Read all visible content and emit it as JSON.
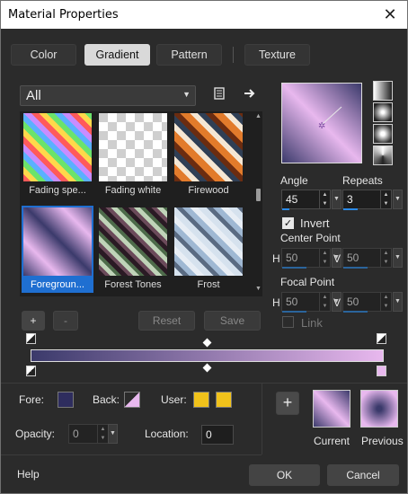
{
  "window": {
    "title": "Material Properties",
    "close_glyph": "✕"
  },
  "tabs": [
    {
      "label": "Color",
      "active": false
    },
    {
      "label": "Gradient",
      "active": true
    },
    {
      "label": "Pattern",
      "active": false
    },
    {
      "label": "Texture",
      "active": false
    }
  ],
  "filter": {
    "selected": "All"
  },
  "gallery": {
    "items": [
      {
        "label": "Fading spe...",
        "selected": false
      },
      {
        "label": "Fading white",
        "selected": false
      },
      {
        "label": "Firewood",
        "selected": false
      },
      {
        "label": "Foregroun...",
        "selected": true
      },
      {
        "label": "Forest Tones",
        "selected": false
      },
      {
        "label": "Frost",
        "selected": false
      }
    ]
  },
  "gallery_buttons": {
    "add": "+",
    "remove": "-",
    "reset": "Reset",
    "save": "Save"
  },
  "angle": {
    "label": "Angle",
    "value": "45"
  },
  "repeats": {
    "label": "Repeats",
    "value": "3"
  },
  "invert": {
    "label": "Invert",
    "checked": true
  },
  "center_point": {
    "label": "Center Point",
    "h_label": "H",
    "h_value": "50",
    "v_label": "V",
    "v_value": "50"
  },
  "focal_point": {
    "label": "Focal Point",
    "h_label": "H",
    "h_value": "50",
    "v_label": "V",
    "v_value": "50"
  },
  "link": {
    "label": "Link",
    "checked": false
  },
  "colors": {
    "fore_label": "Fore:",
    "back_label": "Back:",
    "user_label": "User:",
    "fore_color": "#2e2d5e",
    "user_color": "#f1c21b",
    "gradient_start": "#3b3a6b",
    "gradient_end": "#e8b8ee"
  },
  "opacity": {
    "label": "Opacity:",
    "value": "0"
  },
  "location": {
    "label": "Location:",
    "value": "0"
  },
  "swatches": {
    "add": "+",
    "current_label": "Current",
    "previous_label": "Previous"
  },
  "footer": {
    "help": "Help",
    "ok": "OK",
    "cancel": "Cancel"
  }
}
